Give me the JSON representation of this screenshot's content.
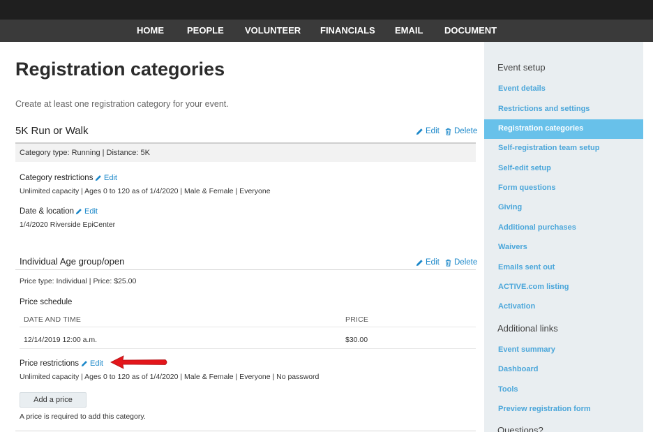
{
  "nav": {
    "items": [
      "HOME",
      "PEOPLE",
      "VOLUNTEER",
      "FINANCIALS",
      "EMAIL",
      "DOCUMENT"
    ]
  },
  "page": {
    "title": "Registration categories",
    "intro": "Create at least one registration category for your event."
  },
  "category": {
    "name": "5K Run or Walk",
    "edit_label": "Edit",
    "delete_label": "Delete",
    "info": "Category type: Running | Distance: 5K",
    "restrictions_label": "Category restrictions",
    "restrictions_value": "Unlimited capacity | Ages 0 to 120 as of 1/4/2020 | Male & Female | Everyone",
    "date_location_label": "Date & location",
    "date_location_value": "1/4/2020 Riverside EpiCenter"
  },
  "price": {
    "name": "Individual Age group/open",
    "edit_label": "Edit",
    "delete_label": "Delete",
    "info": "Price type: Individual | Price: $25.00",
    "schedule_label": "Price schedule",
    "columns": [
      "DATE AND TIME",
      "PRICE"
    ],
    "rows": [
      {
        "date": "12/14/2019 12:00 a.m.",
        "price": "$30.00"
      }
    ],
    "restrictions_label": "Price restrictions",
    "restrictions_value": "Unlimited capacity | Ages 0 to 120 as of 1/4/2020 | Male & Female | Everyone | No password",
    "add_button": "Add a price",
    "note": "A price is required to add this category."
  },
  "sidebar": {
    "setup_header": "Event setup",
    "setup_items": [
      "Event details",
      "Restrictions and settings",
      "Registration categories",
      "Self-registration team setup",
      "Self-edit setup",
      "Form questions",
      "Giving",
      "Additional purchases",
      "Waivers",
      "Emails sent out",
      "ACTIVE.com listing",
      "Activation"
    ],
    "links_header": "Additional links",
    "link_items": [
      "Event summary",
      "Dashboard",
      "Tools",
      "Preview registration form"
    ],
    "questions_header": "Questions?"
  },
  "colors": {
    "link": "#1a87c9",
    "sidebar_active": "#68c1ea",
    "arrow": "#e3161b"
  },
  "icons": {
    "edit": "pencil-icon",
    "delete": "trash-icon",
    "annotation": "red-arrow-icon"
  }
}
